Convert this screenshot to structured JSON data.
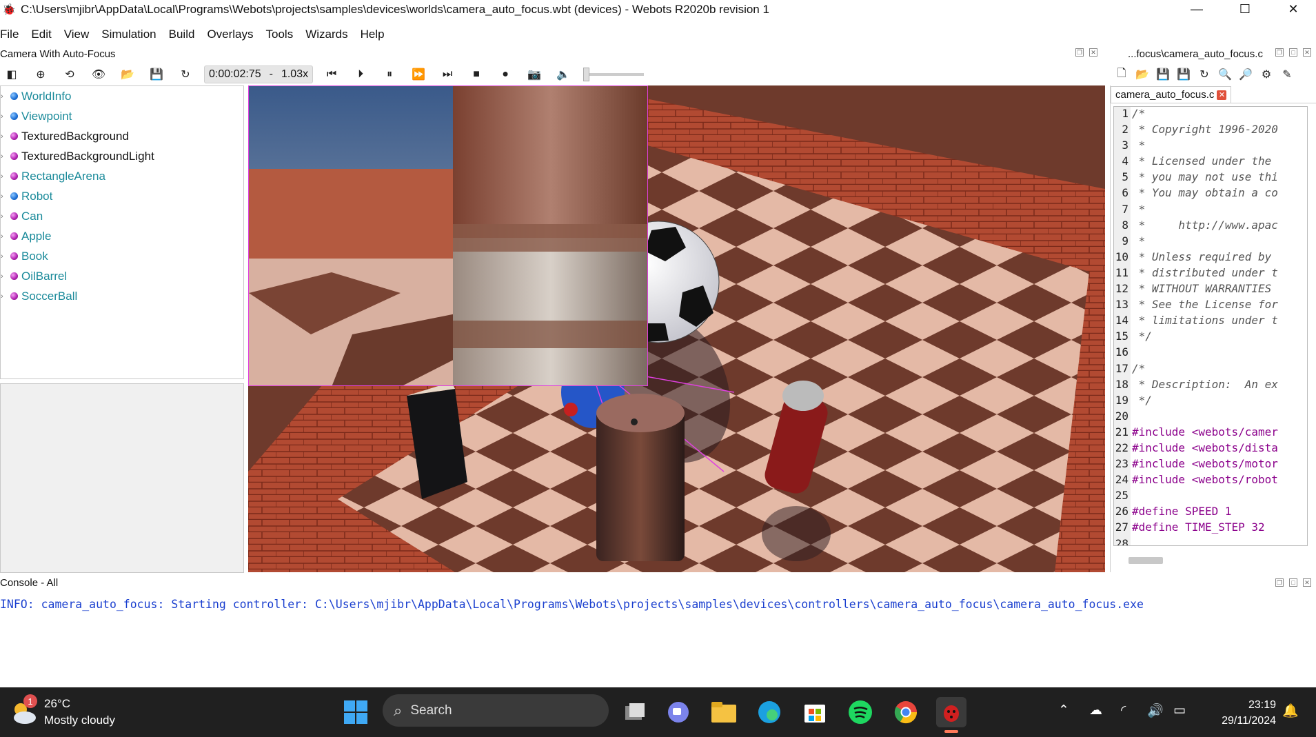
{
  "window": {
    "title": "C:\\Users\\mjibr\\AppData\\Local\\Programs\\Webots\\projects\\samples\\devices\\worlds\\camera_auto_focus.wbt (devices) - Webots R2020b revision 1",
    "minimize": "—",
    "maximize": "☐",
    "close": "✕"
  },
  "menu": [
    "File",
    "Edit",
    "View",
    "Simulation",
    "Build",
    "Overlays",
    "Tools",
    "Wizards",
    "Help"
  ],
  "scene_panel": {
    "title": "Camera With Auto-Focus",
    "time": "0:00:02:75",
    "time_sep": "-",
    "speed": "1.03x"
  },
  "scene_tree": [
    {
      "label": "WorldInfo",
      "color": "blue",
      "link": true
    },
    {
      "label": "Viewpoint",
      "color": "blue",
      "link": true
    },
    {
      "label": "TexturedBackground",
      "color": "purple",
      "link": false
    },
    {
      "label": "TexturedBackgroundLight",
      "color": "purple",
      "link": false
    },
    {
      "label": "RectangleArena",
      "color": "purple",
      "link": true
    },
    {
      "label": "Robot",
      "color": "blue",
      "link": true
    },
    {
      "label": "Can",
      "color": "purple",
      "link": true
    },
    {
      "label": "Apple",
      "color": "purple",
      "link": true
    },
    {
      "label": "Book",
      "color": "purple",
      "link": true
    },
    {
      "label": "OilBarrel",
      "color": "purple",
      "link": true
    },
    {
      "label": "SoccerBall",
      "color": "purple",
      "link": true
    }
  ],
  "editor": {
    "title": "...focus\\camera_auto_focus.c",
    "tab_label": "camera_auto_focus.c",
    "lines": [
      {
        "n": "1",
        "t": "/*",
        "k": "cm"
      },
      {
        "n": "2",
        "t": " * Copyright 1996-2020",
        "k": "cm"
      },
      {
        "n": "3",
        "t": " *",
        "k": "cm"
      },
      {
        "n": "4",
        "t": " * Licensed under the",
        "k": "cm"
      },
      {
        "n": "5",
        "t": " * you may not use thi",
        "k": "cm"
      },
      {
        "n": "6",
        "t": " * You may obtain a co",
        "k": "cm"
      },
      {
        "n": "7",
        "t": " *",
        "k": "cm"
      },
      {
        "n": "8",
        "t": " *     http://www.apac",
        "k": "cm"
      },
      {
        "n": "9",
        "t": " *",
        "k": "cm"
      },
      {
        "n": "10",
        "t": " * Unless required by",
        "k": "cm"
      },
      {
        "n": "11",
        "t": " * distributed under t",
        "k": "cm"
      },
      {
        "n": "12",
        "t": " * WITHOUT WARRANTIES",
        "k": "cm"
      },
      {
        "n": "13",
        "t": " * See the License for",
        "k": "cm"
      },
      {
        "n": "14",
        "t": " * limitations under t",
        "k": "cm"
      },
      {
        "n": "15",
        "t": " */",
        "k": "cm"
      },
      {
        "n": "16",
        "t": "",
        "k": "cm"
      },
      {
        "n": "17",
        "t": "/*",
        "k": "cm"
      },
      {
        "n": "18",
        "t": " * Description:  An ex",
        "k": "cm"
      },
      {
        "n": "19",
        "t": " */",
        "k": "cm"
      },
      {
        "n": "20",
        "t": "",
        "k": "cm"
      },
      {
        "n": "21",
        "t": "#include <webots/camer",
        "k": "pp"
      },
      {
        "n": "22",
        "t": "#include <webots/dista",
        "k": "pp"
      },
      {
        "n": "23",
        "t": "#include <webots/motor",
        "k": "pp"
      },
      {
        "n": "24",
        "t": "#include <webots/robot",
        "k": "pp"
      },
      {
        "n": "25",
        "t": "",
        "k": "pp"
      },
      {
        "n": "26",
        "t": "#define SPEED 1",
        "k": "pp"
      },
      {
        "n": "27",
        "t": "#define TIME_STEP 32",
        "k": "pp"
      },
      {
        "n": "28",
        "t": "",
        "k": "pp"
      }
    ]
  },
  "console": {
    "title": "Console - All",
    "message": "INFO: camera_auto_focus: Starting controller: C:\\Users\\mjibr\\AppData\\Local\\Programs\\Webots\\projects\\samples\\devices\\controllers\\camera_auto_focus\\camera_auto_focus.exe"
  },
  "taskbar": {
    "weather_badge": "1",
    "temperature": "26°C",
    "condition": "Mostly cloudy",
    "search_label": "Search",
    "time": "23:19",
    "date": "29/11/2024"
  },
  "colors": {
    "link": "#1a8a9a",
    "console_text": "#1a3fcf",
    "overlay_border": "#e040e0",
    "taskbar_bg": "#202020"
  }
}
